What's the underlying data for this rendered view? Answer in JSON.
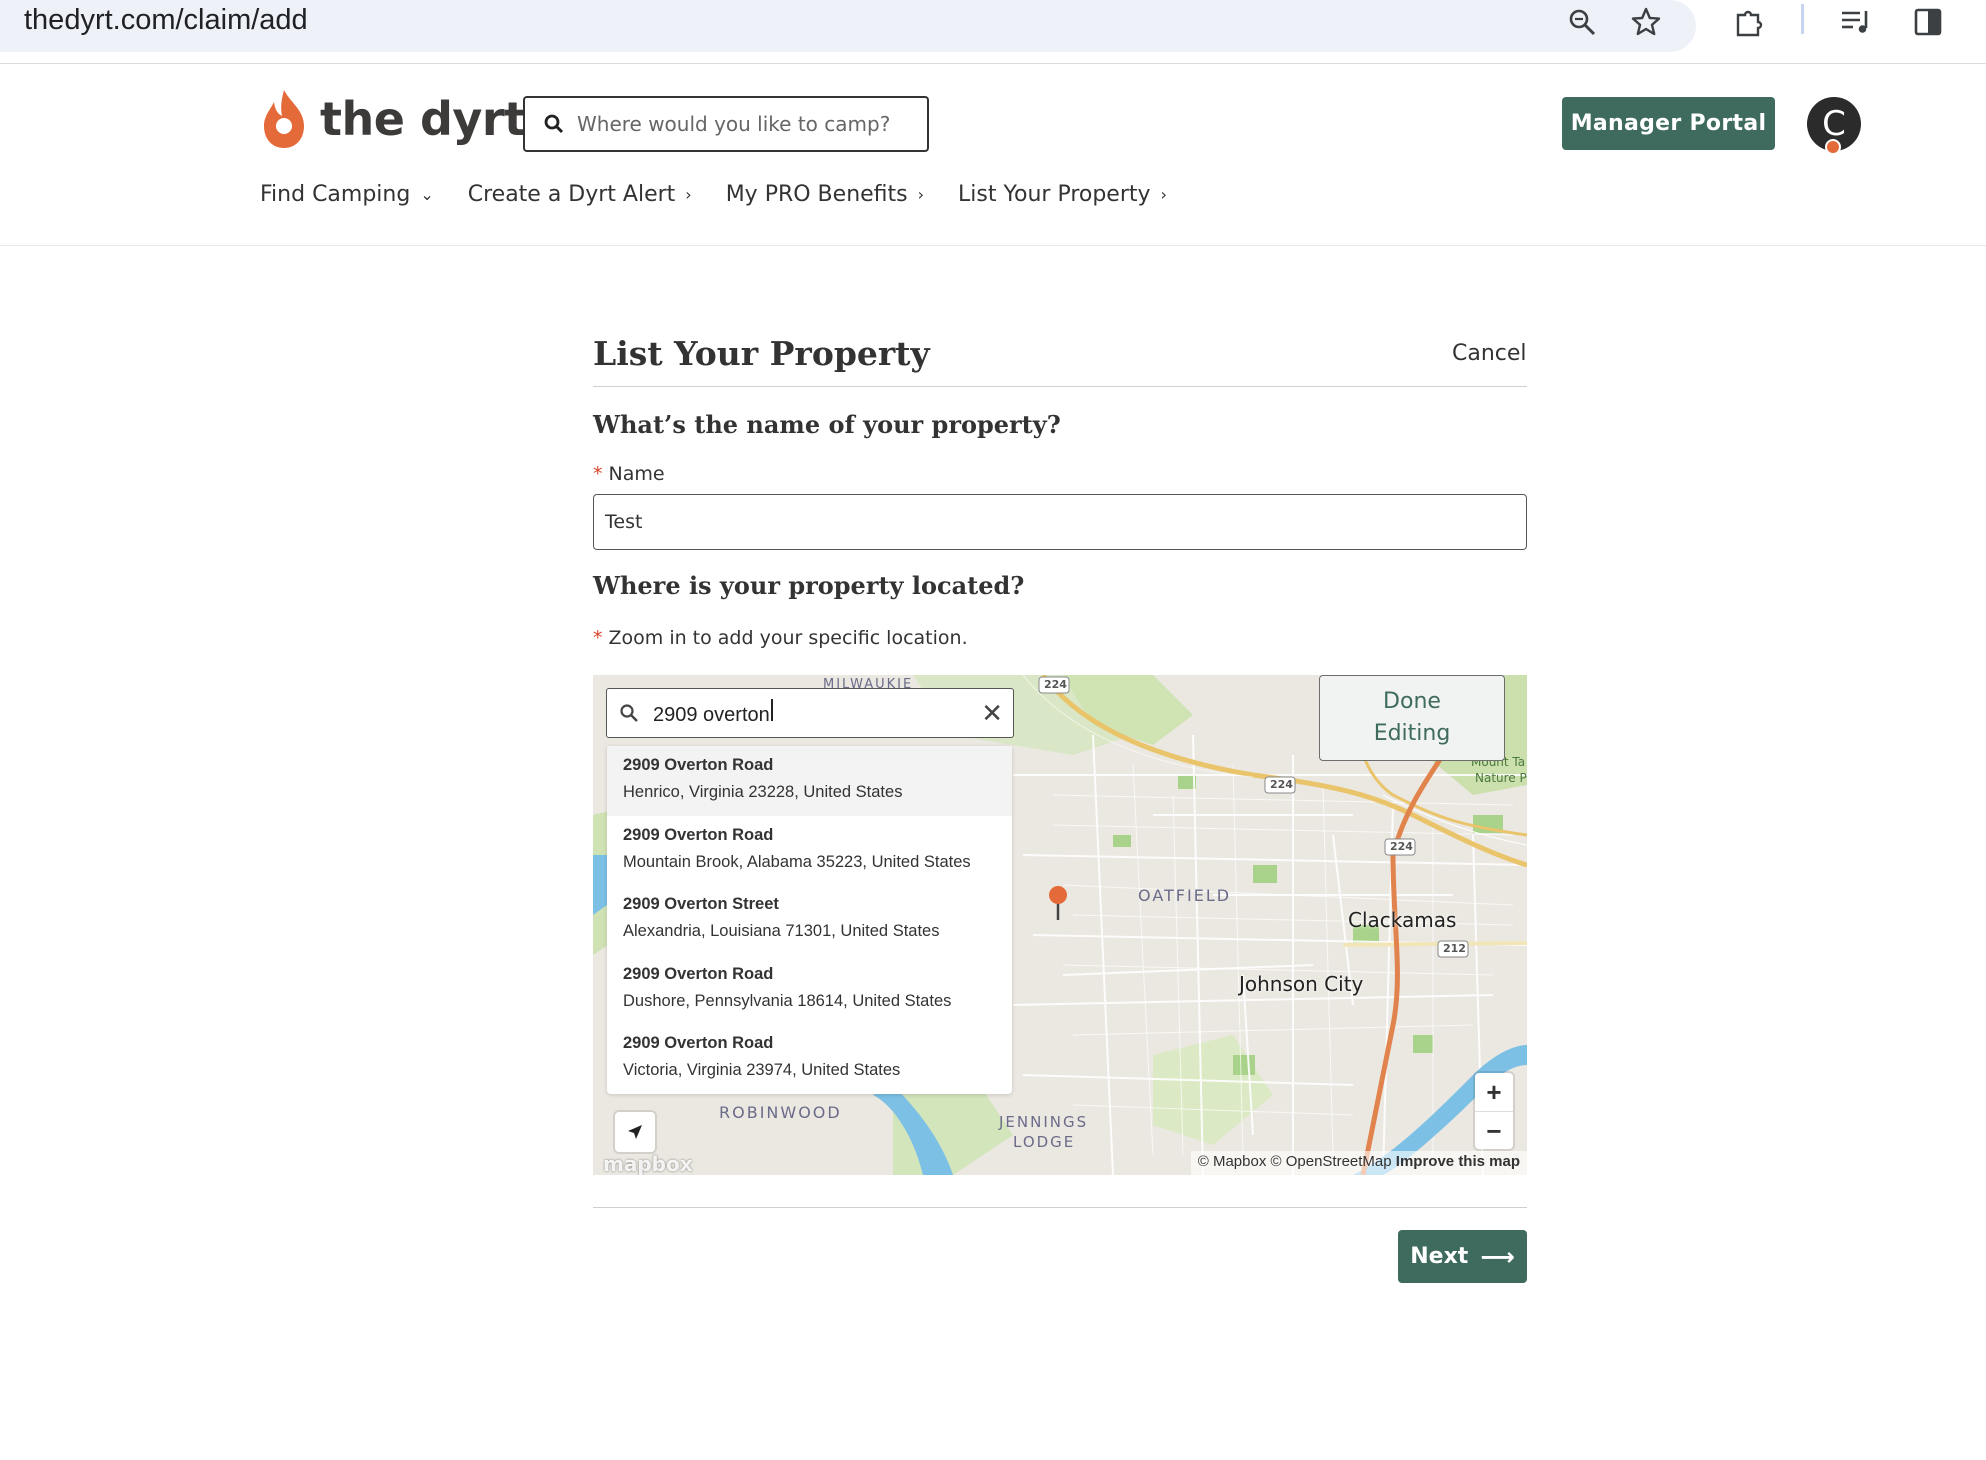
{
  "browser": {
    "url": "thedyrt.com/claim/add",
    "icons": [
      "zoom-icon",
      "bookmark-star-icon",
      "extensions-icon",
      "reading-list-icon",
      "side-panel-icon"
    ]
  },
  "header": {
    "logo_text": "the dyrt",
    "search_placeholder": "Where would you like to camp?",
    "manager_portal_label": "Manager Portal",
    "avatar_initial": "C",
    "nav": [
      {
        "label": "Find Camping"
      },
      {
        "label": "Create a Dyrt Alert"
      },
      {
        "label": "My PRO Benefits"
      },
      {
        "label": "List Your Property"
      }
    ]
  },
  "form": {
    "title": "List Your Property",
    "cancel_label": "Cancel",
    "name_question": "What’s the name of your property?",
    "name_label": "Name",
    "name_value": "Test",
    "location_question": "Where is your property located?",
    "location_hint": "Zoom in to add your specific location.",
    "next_label": "Next"
  },
  "map": {
    "search_value": "2909 overton",
    "done_label_line1": "Done",
    "done_label_line2": "Editing",
    "suggestions": [
      {
        "title": "2909 Overton Road",
        "subtitle": "Henrico, Virginia 23228, United States"
      },
      {
        "title": "2909 Overton Road",
        "subtitle": "Mountain Brook, Alabama 35223, United States"
      },
      {
        "title": "2909 Overton Street",
        "subtitle": "Alexandria, Louisiana 71301, United States"
      },
      {
        "title": "2909 Overton Road",
        "subtitle": "Dushore, Pennsylvania 18614, United States"
      },
      {
        "title": "2909 Overton Road",
        "subtitle": "Victoria, Virginia 23974, United States"
      }
    ],
    "labels": {
      "clackamas": "Clackamas",
      "johnson_city": "Johnson City",
      "oatfield": "OATFIELD",
      "robinwood": "ROBINWOOD",
      "jennings": "JENNINGS",
      "lodge": "LODGE",
      "milwaukie": "MILWAUKIE",
      "nature_park_1": "Mount Ta",
      "nature_park_2": "Nature P",
      "route_224_a": "224",
      "route_224_b": "224",
      "route_224_c": "224",
      "route_212": "212"
    },
    "attribution_text": "© Mapbox © OpenStreetMap",
    "improve_label": "Improve this map",
    "mapbox_logo": "mapbox",
    "zoom_in": "+",
    "zoom_out": "−",
    "clear": "✕",
    "colors": {
      "water": "#7dc0e6",
      "park": "#c6dfa6",
      "highway": "#e9c46a",
      "interstate": "#e0834c"
    }
  },
  "colors": {
    "brand_green": "#3e6b5e",
    "brand_orange": "#e56a3a",
    "required": "#d9462b"
  }
}
